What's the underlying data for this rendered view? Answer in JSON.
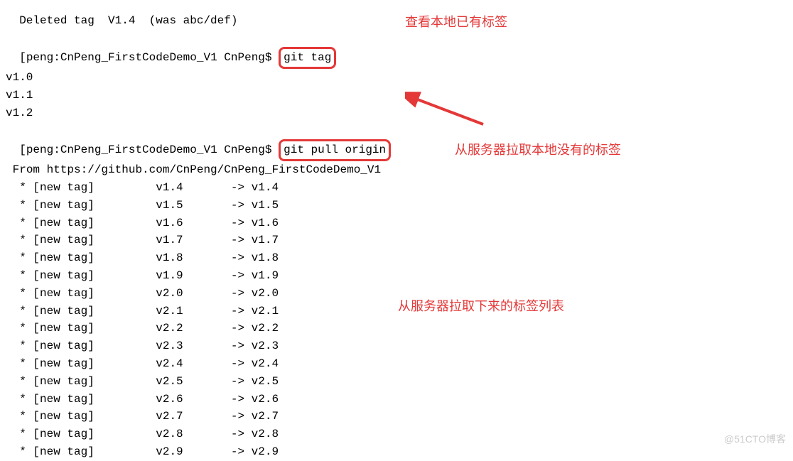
{
  "annotations": {
    "ann1": "查看本地已有标签",
    "ann2": "从服务器拉取本地没有的标签",
    "ann3": "从服务器拉取下来的标签列表"
  },
  "watermark": "@51CTO博客",
  "prompt": {
    "line0_partial": "Deleted tag  V1.4  (was abc/def)",
    "user": "peng",
    "path": "CnPeng_FirstCodeDemo_V1",
    "name": "CnPeng",
    "dollar": "$"
  },
  "commands": {
    "git_tag": "git tag",
    "git_pull": "git pull origin"
  },
  "local_tags": [
    "v1.0",
    "v1.1",
    "v1.2"
  ],
  "from_url": "From https://github.com/CnPeng/CnPeng_FirstCodeDemo_V1",
  "new_tags_label": "[new tag]",
  "arrow_sym": "->",
  "star": "*",
  "new_tags": [
    {
      "local": "v1.4",
      "remote": "v1.4"
    },
    {
      "local": "v1.5",
      "remote": "v1.5"
    },
    {
      "local": "v1.6",
      "remote": "v1.6"
    },
    {
      "local": "v1.7",
      "remote": "v1.7"
    },
    {
      "local": "v1.8",
      "remote": "v1.8"
    },
    {
      "local": "v1.9",
      "remote": "v1.9"
    },
    {
      "local": "v2.0",
      "remote": "v2.0"
    },
    {
      "local": "v2.1",
      "remote": "v2.1"
    },
    {
      "local": "v2.2",
      "remote": "v2.2"
    },
    {
      "local": "v2.3",
      "remote": "v2.3"
    },
    {
      "local": "v2.4",
      "remote": "v2.4"
    },
    {
      "local": "v2.5",
      "remote": "v2.5"
    },
    {
      "local": "v2.6",
      "remote": "v2.6"
    },
    {
      "local": "v2.7",
      "remote": "v2.7"
    },
    {
      "local": "v2.8",
      "remote": "v2.8"
    },
    {
      "local": "v2.9",
      "remote": "v2.9"
    }
  ]
}
